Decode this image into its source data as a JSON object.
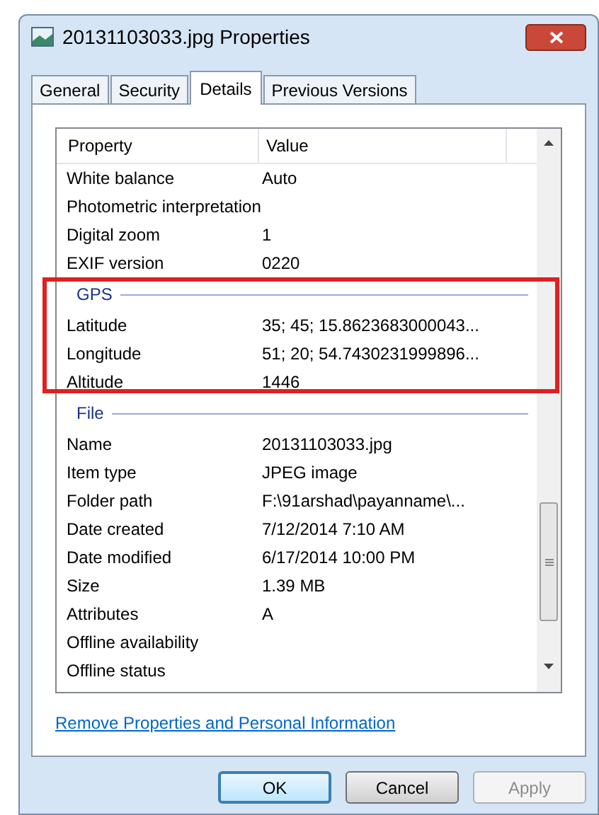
{
  "window": {
    "title": "20131103033.jpg Properties"
  },
  "tabs": [
    {
      "label": "General",
      "selected": false
    },
    {
      "label": "Security",
      "selected": false
    },
    {
      "label": "Details",
      "selected": true
    },
    {
      "label": "Previous Versions",
      "selected": false
    }
  ],
  "table": {
    "columns": [
      "Property",
      "Value"
    ],
    "sections": [
      {
        "highlighted": false,
        "rows": [
          {
            "property": "White balance",
            "value": "Auto"
          },
          {
            "property": "Photometric interpretation",
            "value": ""
          },
          {
            "property": "Digital zoom",
            "value": "1"
          },
          {
            "property": "EXIF version",
            "value": "0220"
          }
        ]
      },
      {
        "heading": "GPS",
        "highlighted": true,
        "rows": [
          {
            "property": "Latitude",
            "value": "35; 45; 15.8623683000043..."
          },
          {
            "property": "Longitude",
            "value": "51; 20; 54.7430231999896..."
          },
          {
            "property": "Altitude",
            "value": "1446"
          }
        ]
      },
      {
        "heading": "File",
        "highlighted": false,
        "rows": [
          {
            "property": "Name",
            "value": "20131103033.jpg"
          },
          {
            "property": "Item type",
            "value": "JPEG image"
          },
          {
            "property": "Folder path",
            "value": "F:\\91arshad\\payanname\\..."
          },
          {
            "property": "Date created",
            "value": "7/12/2014 7:10 AM"
          },
          {
            "property": "Date modified",
            "value": "6/17/2014 10:00 PM"
          },
          {
            "property": "Size",
            "value": "1.39 MB"
          },
          {
            "property": "Attributes",
            "value": "A"
          },
          {
            "property": "Offline availability",
            "value": ""
          },
          {
            "property": "Offline status",
            "value": ""
          }
        ]
      }
    ]
  },
  "link": "Remove Properties and Personal Information",
  "buttons": [
    {
      "label": "OK",
      "default": true,
      "disabled": false
    },
    {
      "label": "Cancel",
      "default": false,
      "disabled": false
    },
    {
      "label": "Apply",
      "default": false,
      "disabled": true
    }
  ]
}
